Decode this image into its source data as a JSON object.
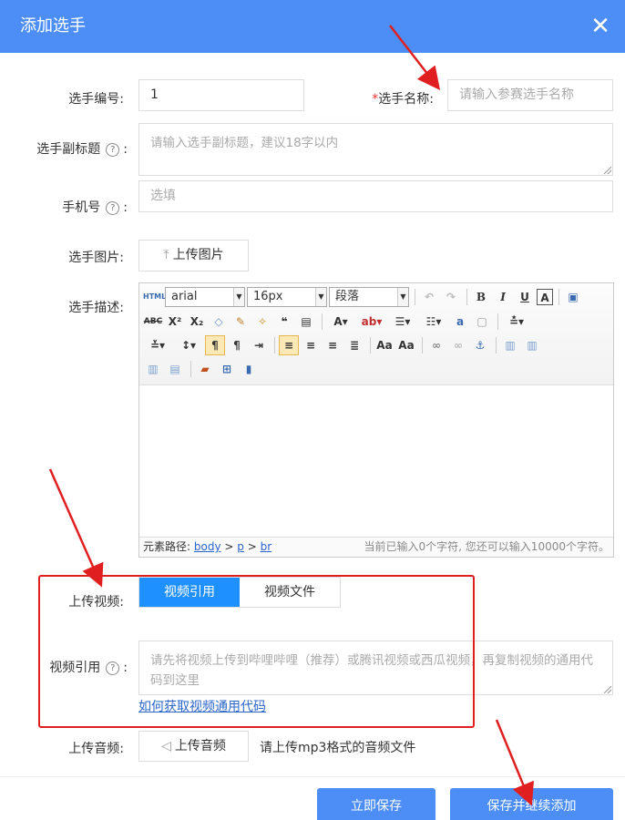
{
  "dialog": {
    "title": "添加选手",
    "close_icon": "close-icon"
  },
  "fields": {
    "number_label": "选手编号:",
    "number_value": "1",
    "name_required_mark": "*",
    "name_label": "选手名称:",
    "name_placeholder": "请输入参赛选手名称",
    "subtitle_label": "选手副标题",
    "subtitle_colon": ":",
    "subtitle_placeholder": "请输入选手副标题，建议18字以内",
    "phone_label": "手机号",
    "phone_colon": ":",
    "phone_placeholder": "选填",
    "image_label": "选手图片:",
    "image_button": "上传图片",
    "desc_label": "选手描述:"
  },
  "editor": {
    "font_family": "arial",
    "font_size": "16px",
    "paragraph": "段落",
    "path_label": "元素路径:",
    "path": [
      "body",
      "p",
      "br"
    ],
    "path_sep": ">",
    "char_count": "当前已输入0个字符, 您还可以输入10000个字符。"
  },
  "video": {
    "upload_label": "上传视频:",
    "tabs": [
      "视频引用",
      "视频文件"
    ],
    "active_tab": 0,
    "ref_label": "视频引用",
    "ref_colon": ":",
    "ref_placeholder": "请先将视频上传到哔哩哔哩（推荐）或腾讯视频或西瓜视频，再复制视频的通用代码到这里",
    "help_link": "如何获取视频通用代码"
  },
  "audio": {
    "label": "上传音频:",
    "button": "上传音频",
    "hint": "请上传mp3格式的音频文件"
  },
  "footer": {
    "save": "立即保存",
    "save_continue": "保存并继续添加"
  },
  "colors": {
    "header": "#4c8ef5",
    "active_tab": "#1e90ff",
    "annotation": "#e02020"
  }
}
